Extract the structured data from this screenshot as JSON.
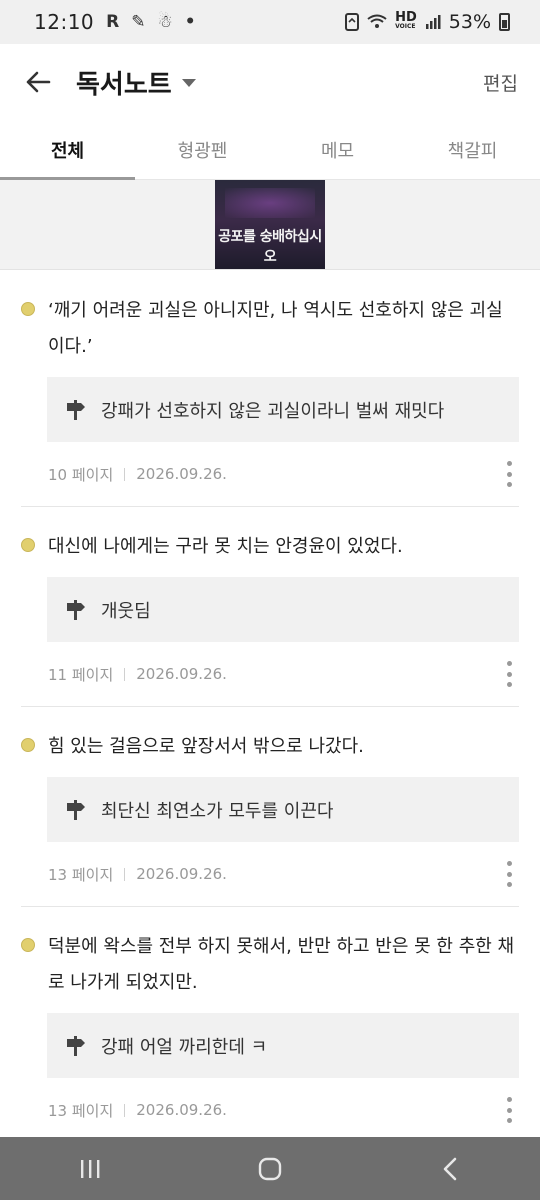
{
  "status_bar": {
    "time": "12:10",
    "icons": [
      "R",
      "✎",
      "☃",
      "•"
    ],
    "hd_label": "HD",
    "voice_label": "VOICE",
    "battery_text": "53%"
  },
  "app_bar": {
    "title": "독서노트",
    "edit_label": "편집"
  },
  "tabs": [
    {
      "label": "전체",
      "active": true
    },
    {
      "label": "형광펜",
      "active": false
    },
    {
      "label": "메모",
      "active": false
    },
    {
      "label": "책갈피",
      "active": false
    }
  ],
  "book": {
    "cover_title": "공포를 숭배하십시오"
  },
  "notes": [
    {
      "quote": "‘깨기 어려운 괴실은 아니지만, 나 역시도 선호하지 않은 괴실이다.’",
      "memo": "강패가 선호하지 않은 괴실이라니 벌써 재밋다",
      "page": "10 페이지",
      "date": "2026.09.26."
    },
    {
      "quote": "대신에 나에게는 구라 못 치는 안경윤이 있었다.",
      "memo": "개웃딤",
      "page": "11 페이지",
      "date": "2026.09.26."
    },
    {
      "quote": "힘 있는 걸음으로 앞장서서 밖으로 나갔다.",
      "memo": "최단신 최연소가 모두를 이끈다",
      "page": "13 페이지",
      "date": "2026.09.26."
    },
    {
      "quote": "덕분에 왁스를 전부 하지 못해서, 반만 하고 반은 못 한 추한 채로 나가게 되었지만.",
      "memo": "강패 어얼 까리한데 ㅋ",
      "page": "13 페이지",
      "date": "2026.09.26."
    }
  ],
  "colors": {
    "highlight_dot": "#e1cf6e",
    "memo_bg": "#f1f1f1",
    "nav_bar": "#6e6e6e"
  },
  "icons": {
    "back": "arrow-left-icon",
    "dropdown": "caret-down-icon",
    "memo": "memo-signpost-icon",
    "more": "more-vertical-icon",
    "nav_recents": "recents-icon",
    "nav_home": "home-icon",
    "nav_back": "chevron-left-icon"
  }
}
